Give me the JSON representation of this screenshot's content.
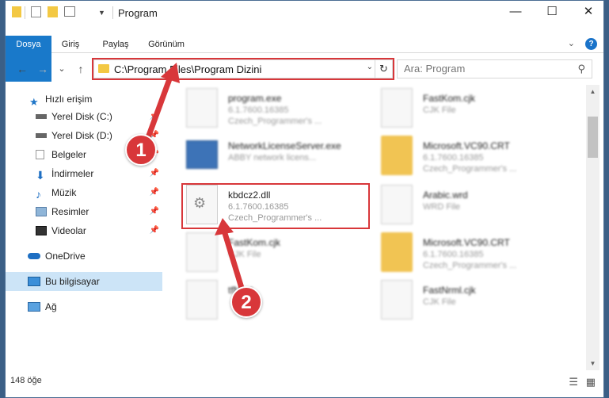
{
  "window": {
    "title": "Program"
  },
  "ribbon": {
    "tabs": [
      {
        "label": "Dosya",
        "active": true
      },
      {
        "label": "Giriş"
      },
      {
        "label": "Paylaş"
      },
      {
        "label": "Görünüm"
      }
    ],
    "help_label": "?"
  },
  "nav": {
    "back_icon": "←",
    "forward_icon": "→",
    "recent_icon": "⌄",
    "up_icon": "↑"
  },
  "address": {
    "path": "C:\\Program Files\\Program Dizini"
  },
  "search": {
    "placeholder": "Ara: Program"
  },
  "sidebar": {
    "items": [
      {
        "label": "Hızlı erişim",
        "icon": "star-icon"
      },
      {
        "label": "Yerel Disk (C:)",
        "icon": "drive-icon",
        "pinned": true
      },
      {
        "label": "Yerel Disk (D:)",
        "icon": "drive-icon",
        "pinned": true
      },
      {
        "label": "Belgeler",
        "icon": "documents-icon",
        "pinned": true
      },
      {
        "label": "İndirmeler",
        "icon": "download-icon",
        "pinned": true
      },
      {
        "label": "Müzik",
        "icon": "music-icon",
        "pinned": true
      },
      {
        "label": "Resimler",
        "icon": "pictures-icon",
        "pinned": true
      },
      {
        "label": "Videolar",
        "icon": "videos-icon",
        "pinned": true
      },
      {
        "label": "OneDrive",
        "icon": "cloud-icon"
      },
      {
        "label": "Bu bilgisayar",
        "icon": "computer-icon",
        "selected": true
      },
      {
        "label": "Ağ",
        "icon": "network-icon"
      }
    ]
  },
  "files": [
    {
      "name": "program.exe",
      "line1": "6.1.7600.16385",
      "line2": "Czech_Programmer's ...",
      "icon": "exe-icon"
    },
    {
      "name": "FastKom.cjk",
      "line1": "CJK File",
      "line2": "",
      "icon": "document-icon"
    },
    {
      "name": "NetworkLicenseServer.exe",
      "line1": "ABBY network licens...",
      "line2": "",
      "icon": "app-icon"
    },
    {
      "name": "Microsoft.VC90.CRT",
      "line1": "6.1.7600.16385",
      "line2": "Czech_Programmer's ...",
      "icon": "folder-icon"
    },
    {
      "name": "kbdcz2.dll",
      "line1": "6.1.7600.16385",
      "line2": "Czech_Programmer's ...",
      "icon": "dll-gear-icon"
    },
    {
      "name": "Arabic.wrd",
      "line1": "WRD File",
      "line2": "",
      "icon": "document-icon"
    },
    {
      "name": "FastKom.cjk",
      "line1": "CJK File",
      "line2": "",
      "icon": "document-icon"
    },
    {
      "name": "Microsoft.VC90.CRT",
      "line1": "6.1.7600.16385",
      "line2": "Czech_Programmer's ...",
      "icon": "folder-icon"
    },
    {
      "name": "tfNext",
      "line1": "",
      "line2": "",
      "icon": "document-icon"
    },
    {
      "name": "FastNrml.cjk",
      "line1": "CJK File",
      "line2": "",
      "icon": "document-icon"
    }
  ],
  "overlay": {
    "badge1": "1",
    "badge2": "2"
  },
  "status": {
    "count": "148 öğe"
  },
  "colors": {
    "accent": "#1979ca",
    "highlight": "#d8373a",
    "selection": "#cce4f7"
  }
}
